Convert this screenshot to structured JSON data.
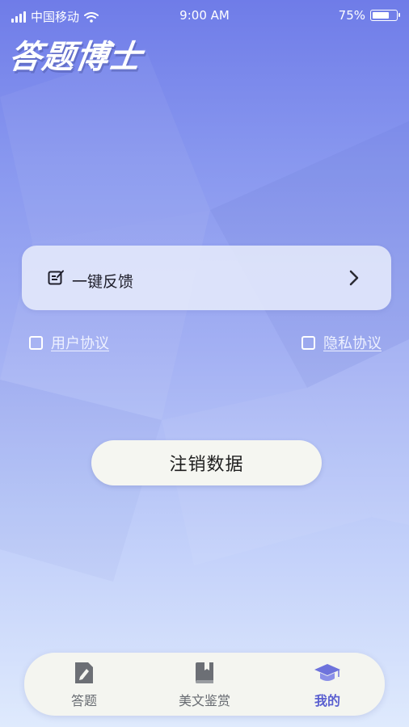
{
  "status_bar": {
    "carrier": "中国移动",
    "time": "9:00 AM",
    "battery_percent": "75%",
    "battery_level": 0.75,
    "icons": [
      "signal-icon",
      "wifi-icon",
      "battery-icon"
    ]
  },
  "logo_text": "答题博士",
  "feedback": {
    "label": "一键反馈",
    "icon": "edit-note-icon",
    "arrow": "chevron-right-icon"
  },
  "agreements": {
    "user": "用户协议",
    "privacy": "隐私协议"
  },
  "logout_button": "注销数据",
  "tabs": [
    {
      "label": "答题",
      "icon": "document-edit-icon",
      "active": false
    },
    {
      "label": "美文鉴赏",
      "icon": "book-icon",
      "active": false
    },
    {
      "label": "我的",
      "icon": "graduation-cap-icon",
      "active": true
    }
  ],
  "colors": {
    "background_top": "#6f7ce8",
    "background_bottom": "#dfeafd",
    "active_tab": "#5a5fd0",
    "inactive_tab": "#666a70"
  }
}
